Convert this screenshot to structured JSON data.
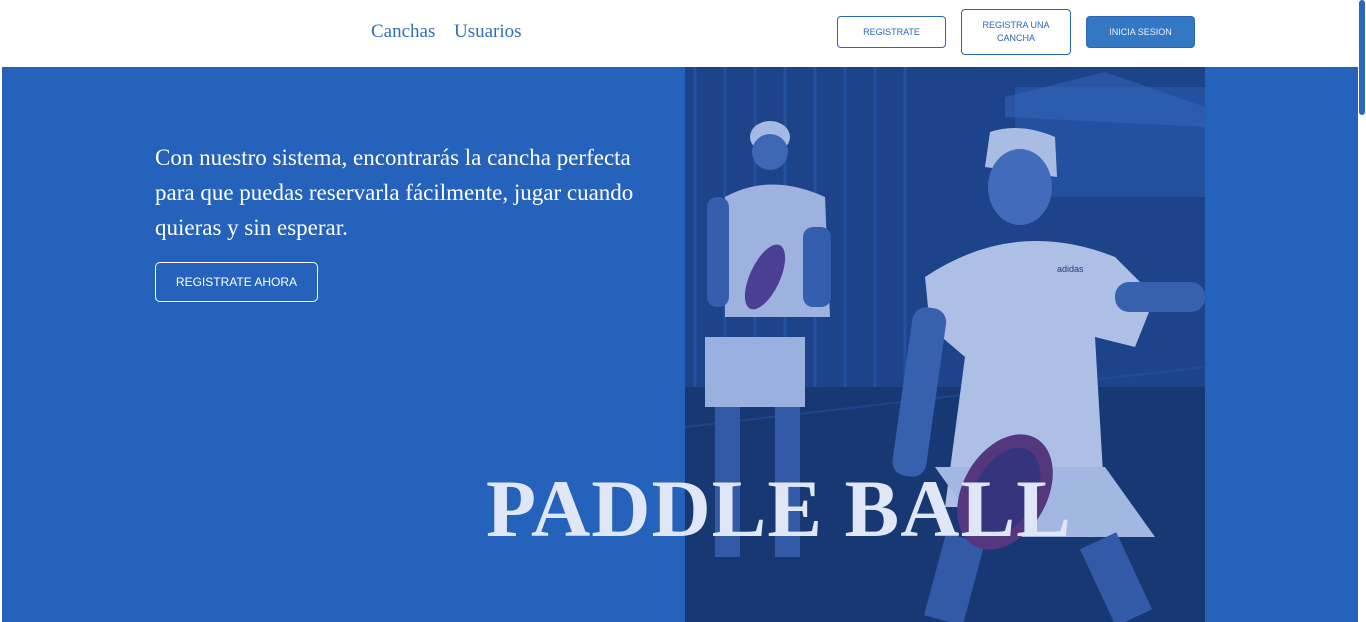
{
  "nav": {
    "links": [
      {
        "label": "Canchas"
      },
      {
        "label": "Usuarios"
      }
    ],
    "buttons": {
      "register": "REGISTRATE",
      "register_court": "REGISTRA UNA CANCHA",
      "login": "INICIA SESION"
    }
  },
  "hero": {
    "text": "Con nuestro sistema, encontrarás la cancha perfecta para que puedas reservarla fácilmente, jugar cuando quieras y sin esperar.",
    "cta": "REGISTRATE AHORA",
    "title": "PADDLE BALL",
    "image_logo_text": "adidas"
  },
  "colors": {
    "hero_bg": "#2462bc",
    "accent": "#2a64b8",
    "nav_link": "#2f6fb8",
    "login_button_bg": "#3478c4"
  }
}
